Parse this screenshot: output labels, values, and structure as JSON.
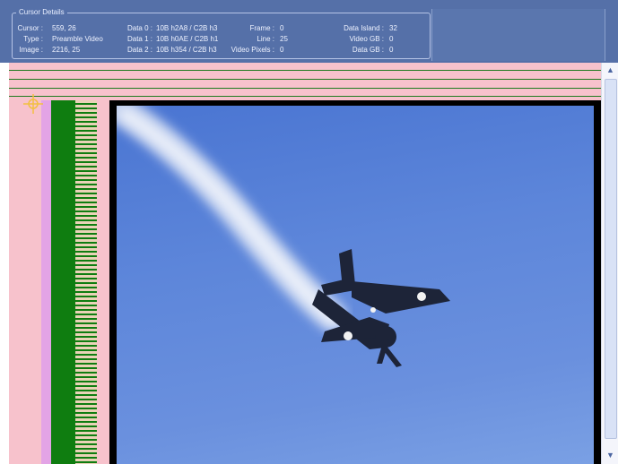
{
  "panel": {
    "title": "Cursor Details",
    "fields": {
      "cursor_label": "Cursor :",
      "cursor_value": "559, 26",
      "type_label": "Type :",
      "type_value": "Preamble Video",
      "image_label": "Image :",
      "image_value": "2216, 25",
      "data0_label": "Data 0 :",
      "data0_value": "10B h2A8 / C2B h3",
      "data1_label": "Data 1 :",
      "data1_value": "10B h0AE / C2B h1",
      "data2_label": "Data 2 :",
      "data2_value": "10B h354 / C2B h3",
      "frame_label": "Frame :",
      "frame_value": "0",
      "line_label": "Line :",
      "line_value": "25",
      "vpixels_label": "Video Pixels :",
      "vpixels_value": "0",
      "data_island_label": "Data Island :",
      "data_island_value": "32",
      "video_gb_label": "Video GB :",
      "video_gb_value": "0",
      "data_gb_label": "Data GB :",
      "data_gb_value": "0"
    }
  },
  "icons": {
    "scroll_up": "scroll-up-arrow-icon",
    "scroll_down": "scroll-down-arrow-icon",
    "crosshair": "crosshair-icon"
  },
  "colors": {
    "panel_bg": "#5570a8",
    "preamble_pink": "#f7c2cc",
    "guard_green": "#0f7d10",
    "sky_blue": "#5d86da"
  }
}
